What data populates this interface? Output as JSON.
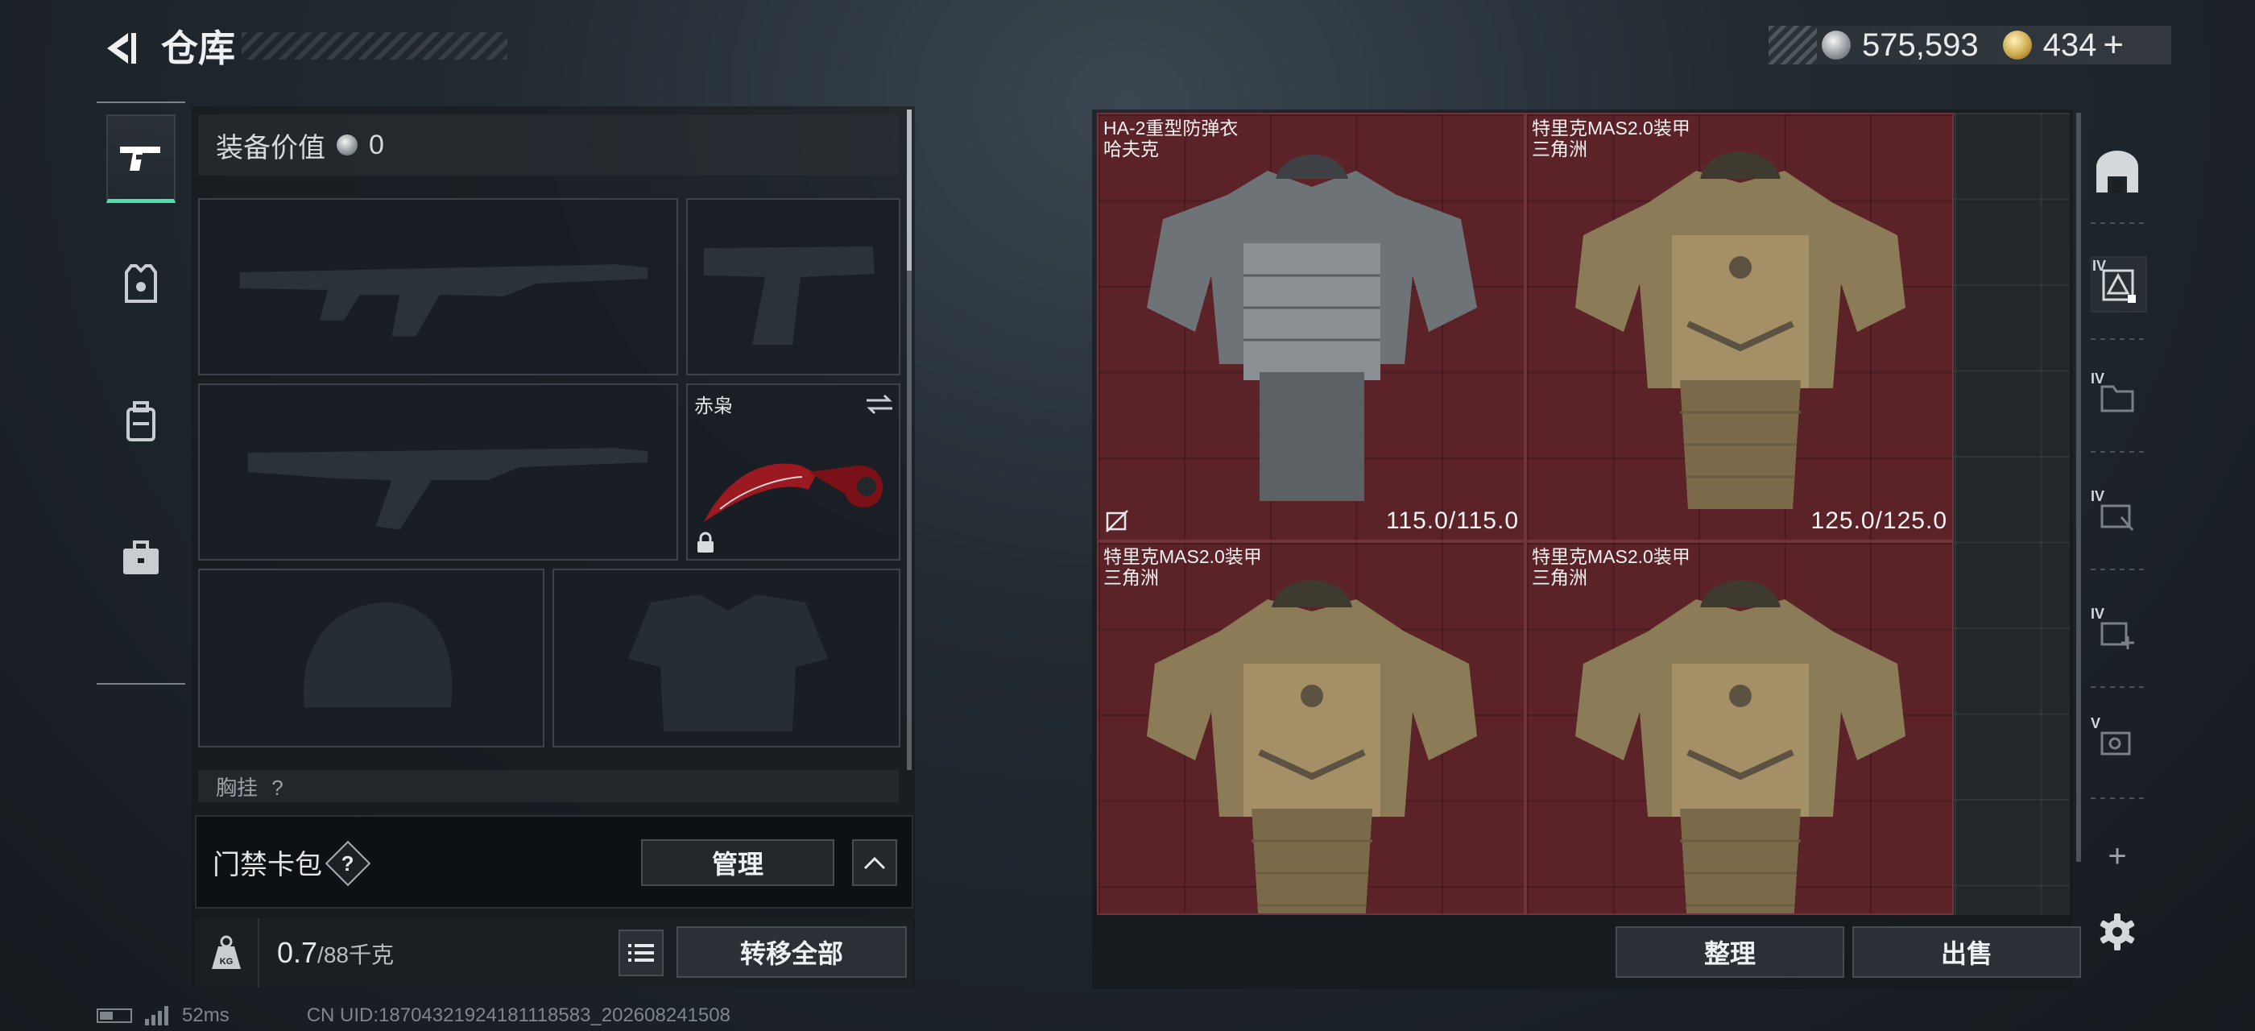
{
  "header": {
    "title": "仓库",
    "currency_silver": "575,593",
    "currency_gold": "434",
    "add_label": "+"
  },
  "loadout": {
    "equip_value_label": "装备价值",
    "equip_value": "0",
    "melee_name": "赤枭",
    "chest_header": "胸挂",
    "chest_suffix": "?"
  },
  "keycard": {
    "label": "门禁卡包",
    "help": "?",
    "manage_label": "管理"
  },
  "weight": {
    "current": "0.7",
    "max_unit": "/88千克",
    "transfer_all_label": "转移全部"
  },
  "stash": {
    "items": [
      {
        "name": "HA-2重型防弹衣",
        "brand": "哈夫克",
        "durability": "115.0/115.0",
        "style": "gray"
      },
      {
        "name": "特里克MAS2.0装甲",
        "brand": "三角洲",
        "durability": "125.0/125.0",
        "style": "tan"
      },
      {
        "name": "特里克MAS2.0装甲",
        "brand": "三角洲",
        "durability": "",
        "style": "tan"
      },
      {
        "name": "特里克MAS2.0装甲",
        "brand": "三角洲",
        "durability": "",
        "style": "tan"
      }
    ],
    "sort_label": "整理",
    "sell_label": "出售"
  },
  "right_rail": {
    "tiers": [
      "IV",
      "IV",
      "IV",
      "IV",
      "V"
    ],
    "add_label": "+"
  },
  "status": {
    "ping": "52ms",
    "uid": "CN UID:18704321924181118583_202608241508"
  },
  "colors": {
    "accent": "#4de0a9",
    "item_bg": "#5b2328",
    "panel_bg": "#22272c"
  }
}
